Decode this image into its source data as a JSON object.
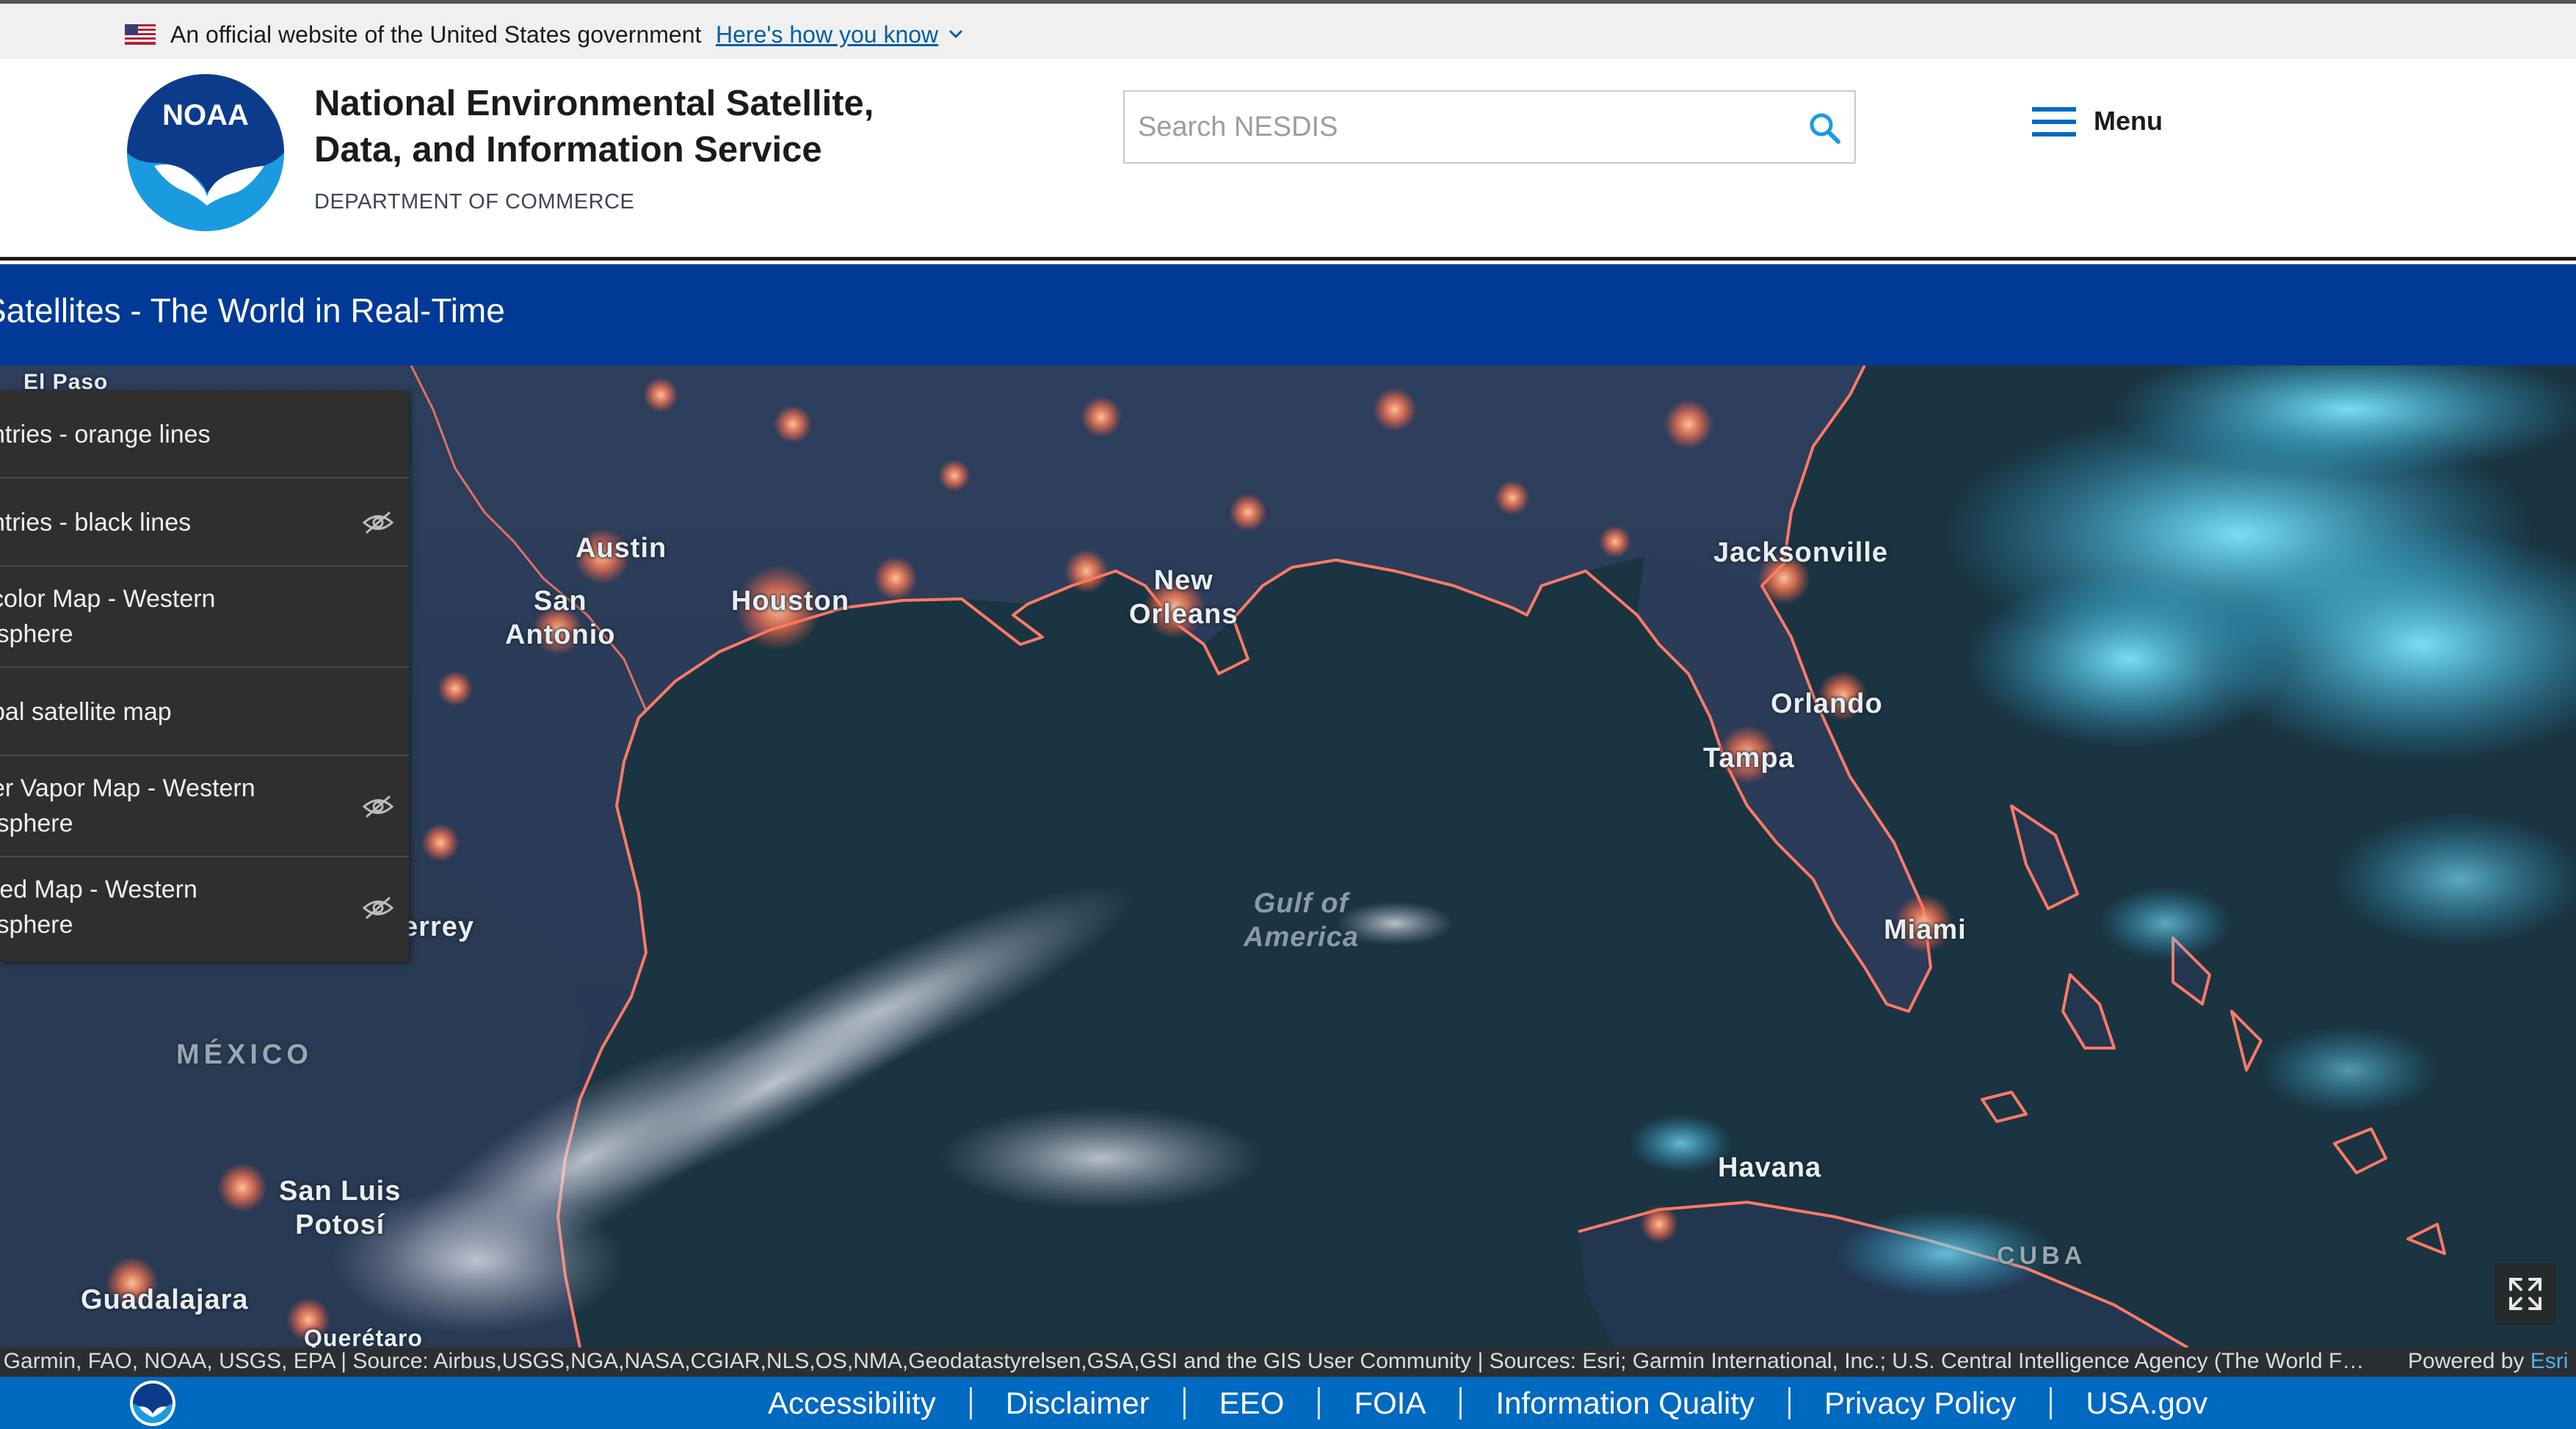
{
  "gov_banner": {
    "text": "An official website of the United States government",
    "link_label": "Here's how you know"
  },
  "header": {
    "logo_text": "NOAA",
    "title": "National Environmental Satellite, Data, and Information Service",
    "subtitle": "DEPARTMENT OF COMMERCE",
    "search_placeholder": "Search NESDIS",
    "menu_label": "Menu"
  },
  "app": {
    "title": "Satellites - The World in Real-Time"
  },
  "layers": [
    {
      "label_line1": "ntries - orange lines",
      "label_line2": "",
      "visible": true
    },
    {
      "label_line1": "ntries - black lines",
      "label_line2": "",
      "visible": false
    },
    {
      "label_line1": "color Map - Western",
      "label_line2": "isphere",
      "visible": true
    },
    {
      "label_line1": "bal satellite map",
      "label_line2": "",
      "visible": true
    },
    {
      "label_line1": "er Vapor Map - Western",
      "label_line2": "isphere",
      "visible": false
    },
    {
      "label_line1": "red Map - Western",
      "label_line2": "isphere",
      "visible": false
    }
  ],
  "map_labels": {
    "el_paso": "El Paso",
    "austin": "Austin",
    "san_antonio": "San\nAntonio",
    "houston": "Houston",
    "new_orleans": "New\nOrleans",
    "jacksonville": "Jacksonville",
    "orlando": "Orlando",
    "tampa": "Tampa",
    "miami": "Miami",
    "gulf": "Gulf of\nAmerica",
    "monterrey": "errey",
    "mexico": "MÉXICO",
    "san_luis": "San Luis\nPotosí",
    "guadalajara": "Guadalajara",
    "queretaro": "Querétaro",
    "havana": "Havana",
    "cuba": "CUBA"
  },
  "attribution": {
    "text": ", Garmin, FAO, NOAA, USGS, EPA | Source: Airbus,USGS,NGA,NASA,CGIAR,NLS,OS,NMA,Geodatastyrelsen,GSA,GSI and the GIS User Community | Sources: Esri; Garmin International, Inc.; U.S. Central Intelligence Agency (The World Fact…",
    "powered_by": "Powered by ",
    "powered_link": "Esri"
  },
  "footer": {
    "links": [
      "Accessibility",
      "Disclaimer",
      "EEO",
      "FOIA",
      "Information Quality",
      "Privacy Policy",
      "USA.gov"
    ]
  },
  "colors": {
    "title_bar": "#003a96",
    "footer": "#0069c0",
    "city_lights": "#ff8a5c",
    "coastline": "#ff7a66",
    "cloud_cyan": "#38c8f0"
  },
  "icons": [
    "us-flag-icon",
    "chevron-down-icon",
    "noaa-logo",
    "search-icon",
    "hamburger-menu-icon",
    "eye-off-icon",
    "expand-icon"
  ]
}
